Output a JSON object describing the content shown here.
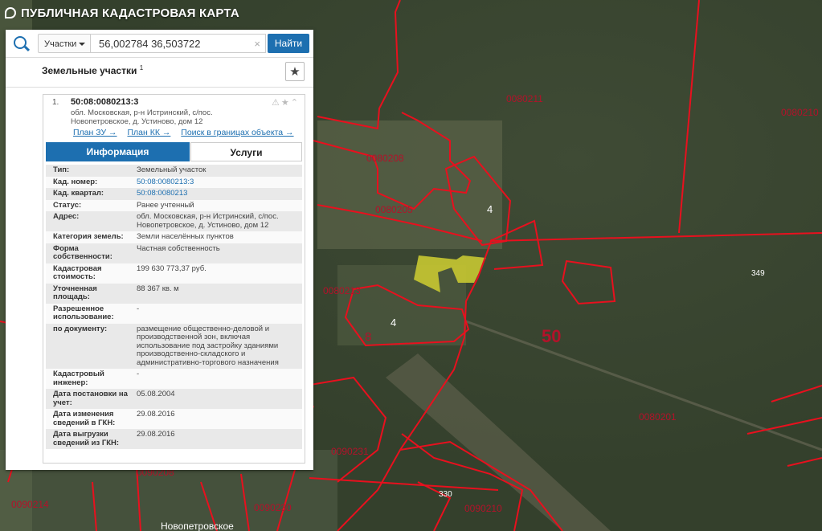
{
  "app": {
    "title": "ПУБЛИЧНАЯ КАДАСТРОВАЯ КАРТА"
  },
  "search": {
    "type_label": "Участки",
    "query": "56,002784 36,503722",
    "clear": "×",
    "find_label": "Найти"
  },
  "panel": {
    "title": "Земельные участки",
    "count": "1",
    "favorite": "★"
  },
  "card": {
    "index": "1.",
    "cad_number": "50:08:0080213:3",
    "address": "обл. Московская, р-н Истринский, с/пос. Новопетровское, д. Устиново, дом 12",
    "icons": "⚠★⌃",
    "links": [
      "План ЗУ →",
      "План КК →",
      "Поиск в границах объекта →"
    ],
    "tabs": [
      "Информация",
      "Услуги"
    ],
    "rows": [
      {
        "key": "Тип:",
        "value": "Земельный участок"
      },
      {
        "key": "Кад. номер:",
        "value": "50:08:0080213:3"
      },
      {
        "key": "Кад. квартал:",
        "value": "50:08:0080213"
      },
      {
        "key": "Статус:",
        "value": "Ранее учтенный"
      },
      {
        "key": "Адрес:",
        "value": "обл. Московская, р-н Истринский, с/пос. Новопетровское, д. Устиново, дом 12"
      },
      {
        "key": "Категория земель:",
        "value": "Земли населённых пунктов"
      },
      {
        "key": "Форма собственности:",
        "value": "Частная собственность"
      },
      {
        "key": "Кадастровая стоимость:",
        "value": "199 630 773,37 руб."
      },
      {
        "key": "Уточненная площадь:",
        "value": "88 367 кв. м"
      },
      {
        "key": "Разрешенное использование:",
        "value": "-"
      },
      {
        "key": "по документу:",
        "value": "размещение общественно-деловой и производственной зон, включая использование под застройку зданиями производственно-складского и административно-торгового назначения"
      },
      {
        "key": "Кадастровый инженер:",
        "value": "-"
      },
      {
        "key": "Дата постановки на учет:",
        "value": "05.08.2004"
      },
      {
        "key": "Дата изменения сведений в ГКН:",
        "value": "29.08.2016"
      },
      {
        "key": "Дата выгрузки сведений из ГКН:",
        "value": "29.08.2016"
      }
    ]
  },
  "map_labels": [
    "0080211",
    "0080210",
    "0080208",
    "0080205",
    "0080213",
    "0080201",
    "0090231",
    "0090208",
    "0090230",
    "0090210",
    "0090214",
    "8",
    "4",
    "4",
    "50",
    "349",
    "330",
    "Новопетровское"
  ],
  "colors": {
    "accent": "#1d6fb0",
    "boundary": "#e8101e",
    "highlight": "#c8c832"
  }
}
